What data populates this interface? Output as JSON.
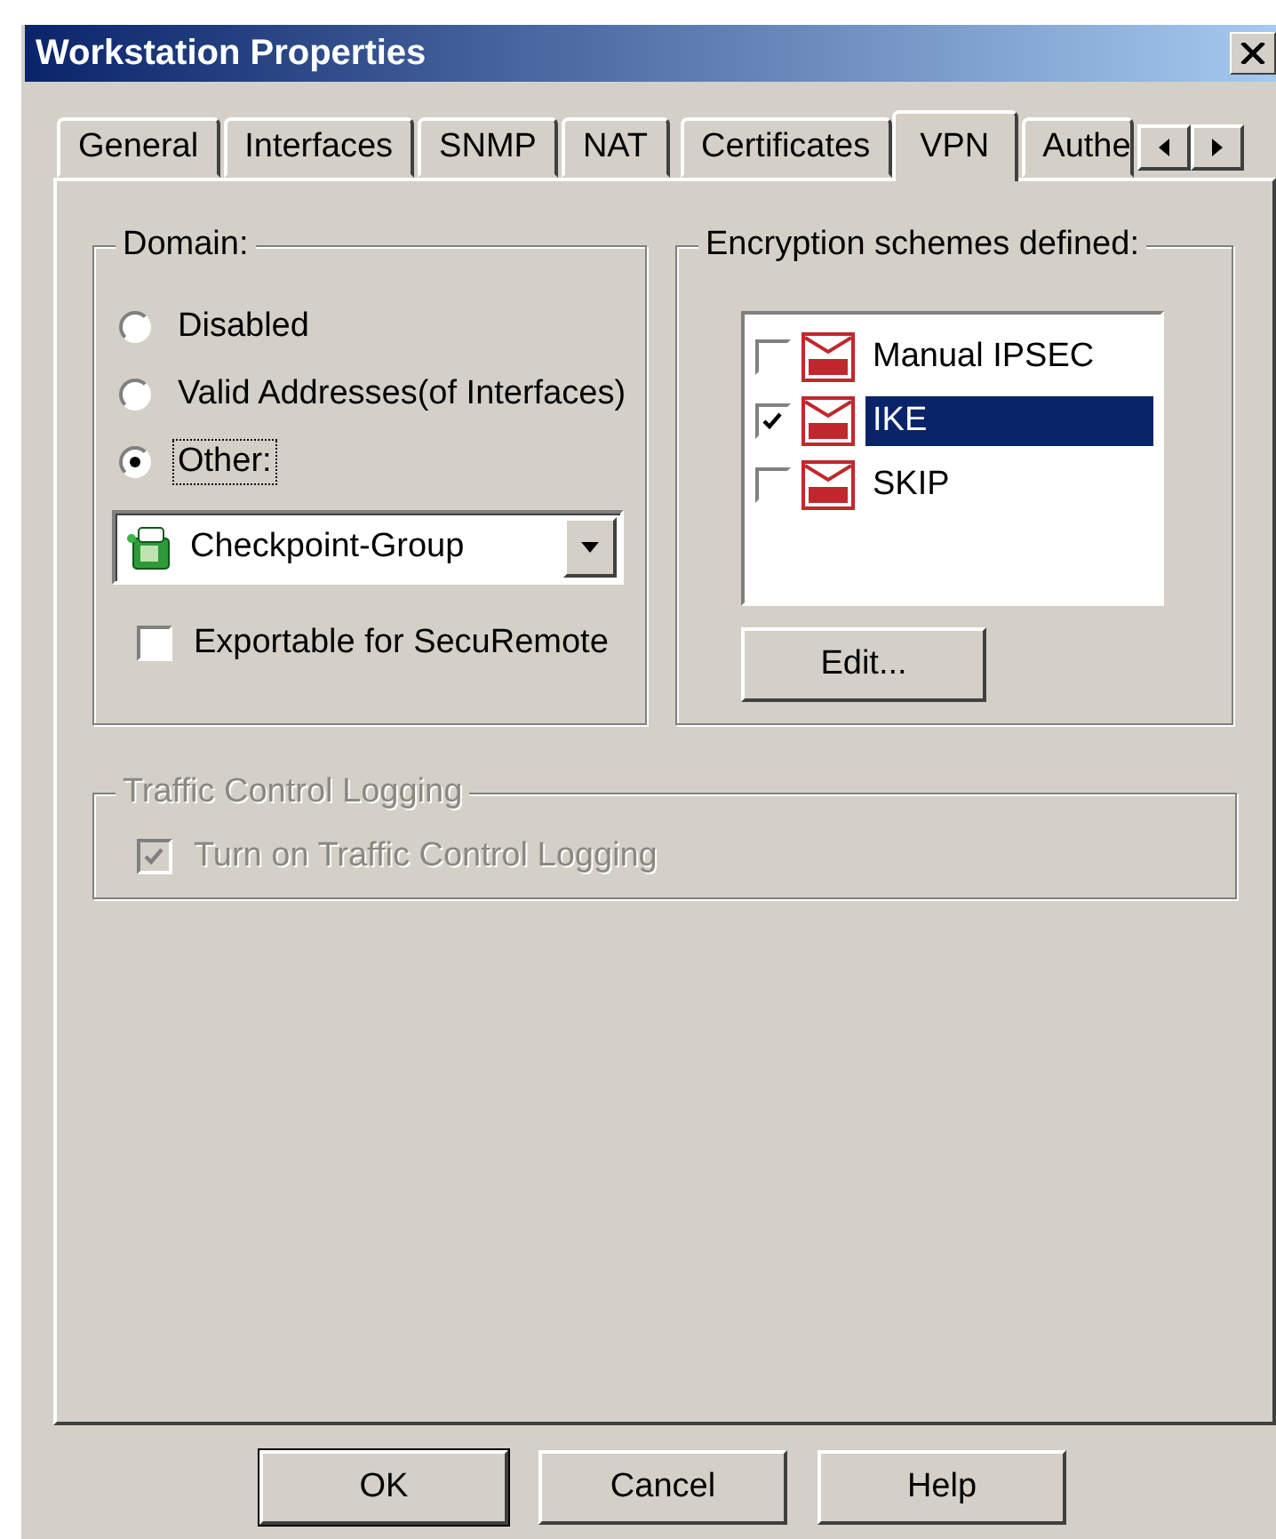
{
  "window": {
    "title": "Workstation Properties"
  },
  "tabs": [
    {
      "label": "General",
      "selected": false
    },
    {
      "label": "Interfaces",
      "selected": false
    },
    {
      "label": "SNMP",
      "selected": false
    },
    {
      "label": "NAT",
      "selected": false
    },
    {
      "label": "Certificates",
      "selected": false
    },
    {
      "label": "VPN",
      "selected": true
    },
    {
      "label": "Authe",
      "selected": false
    }
  ],
  "domain": {
    "title": "Domain:",
    "options": [
      {
        "label": "Disabled",
        "selected": false,
        "focused": false
      },
      {
        "label": "Valid Addresses(of Interfaces)",
        "selected": false,
        "focused": false
      },
      {
        "label": "Other:",
        "selected": true,
        "focused": true
      }
    ],
    "group_combo": {
      "value": "Checkpoint-Group"
    },
    "exportable": {
      "label": "Exportable for SecuRemote",
      "checked": false
    }
  },
  "encryption": {
    "title": "Encryption schemes defined:",
    "schemes": [
      {
        "label": "Manual IPSEC",
        "checked": false,
        "selected": false
      },
      {
        "label": "IKE",
        "checked": true,
        "selected": true
      },
      {
        "label": "SKIP",
        "checked": false,
        "selected": false
      }
    ],
    "edit_button": "Edit..."
  },
  "traffic_control_logging": {
    "title": "Traffic Control Logging",
    "disabled": true,
    "checkbox": {
      "label": "Turn on Traffic Control Logging",
      "checked": true
    }
  },
  "buttons": [
    {
      "label": "OK",
      "default": true
    },
    {
      "label": "Cancel",
      "default": false
    },
    {
      "label": "Help",
      "default": false
    }
  ]
}
